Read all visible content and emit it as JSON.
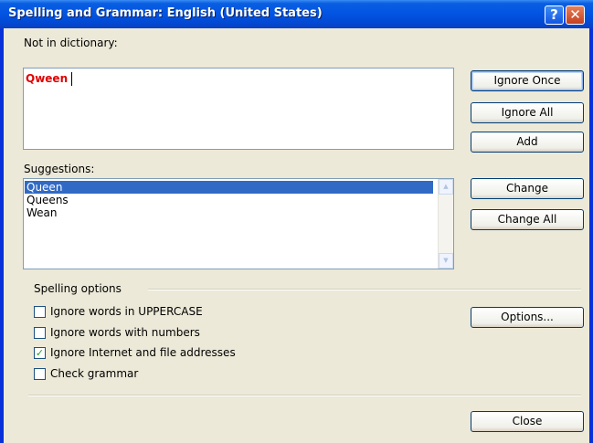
{
  "window": {
    "title": "Spelling and Grammar: English (United States)",
    "help_glyph": "?",
    "close_glyph": "✕"
  },
  "not_in_dictionary": {
    "label": "Not in dictionary:",
    "word": "Qween"
  },
  "suggestions": {
    "label": "Suggestions:",
    "items": [
      "Queen",
      "Queens",
      "Wean"
    ],
    "selected": "Queen"
  },
  "buttons": {
    "ignore_once": "Ignore Once",
    "ignore_all": "Ignore All",
    "add": "Add",
    "change": "Change",
    "change_all": "Change All",
    "options": "Options...",
    "close": "Close"
  },
  "spelling_options": {
    "label": "Spelling options",
    "checkboxes": [
      {
        "label": "Ignore words in UPPERCASE",
        "checked": false
      },
      {
        "label": "Ignore words with numbers",
        "checked": false
      },
      {
        "label": "Ignore Internet and file addresses",
        "checked": true
      },
      {
        "label": "Check grammar",
        "checked": false
      }
    ]
  },
  "colors": {
    "titlebar": "#0355e3",
    "dialog_bg": "#ece9d8",
    "misspelled_text": "#e00000",
    "selection": "#316ac5"
  }
}
